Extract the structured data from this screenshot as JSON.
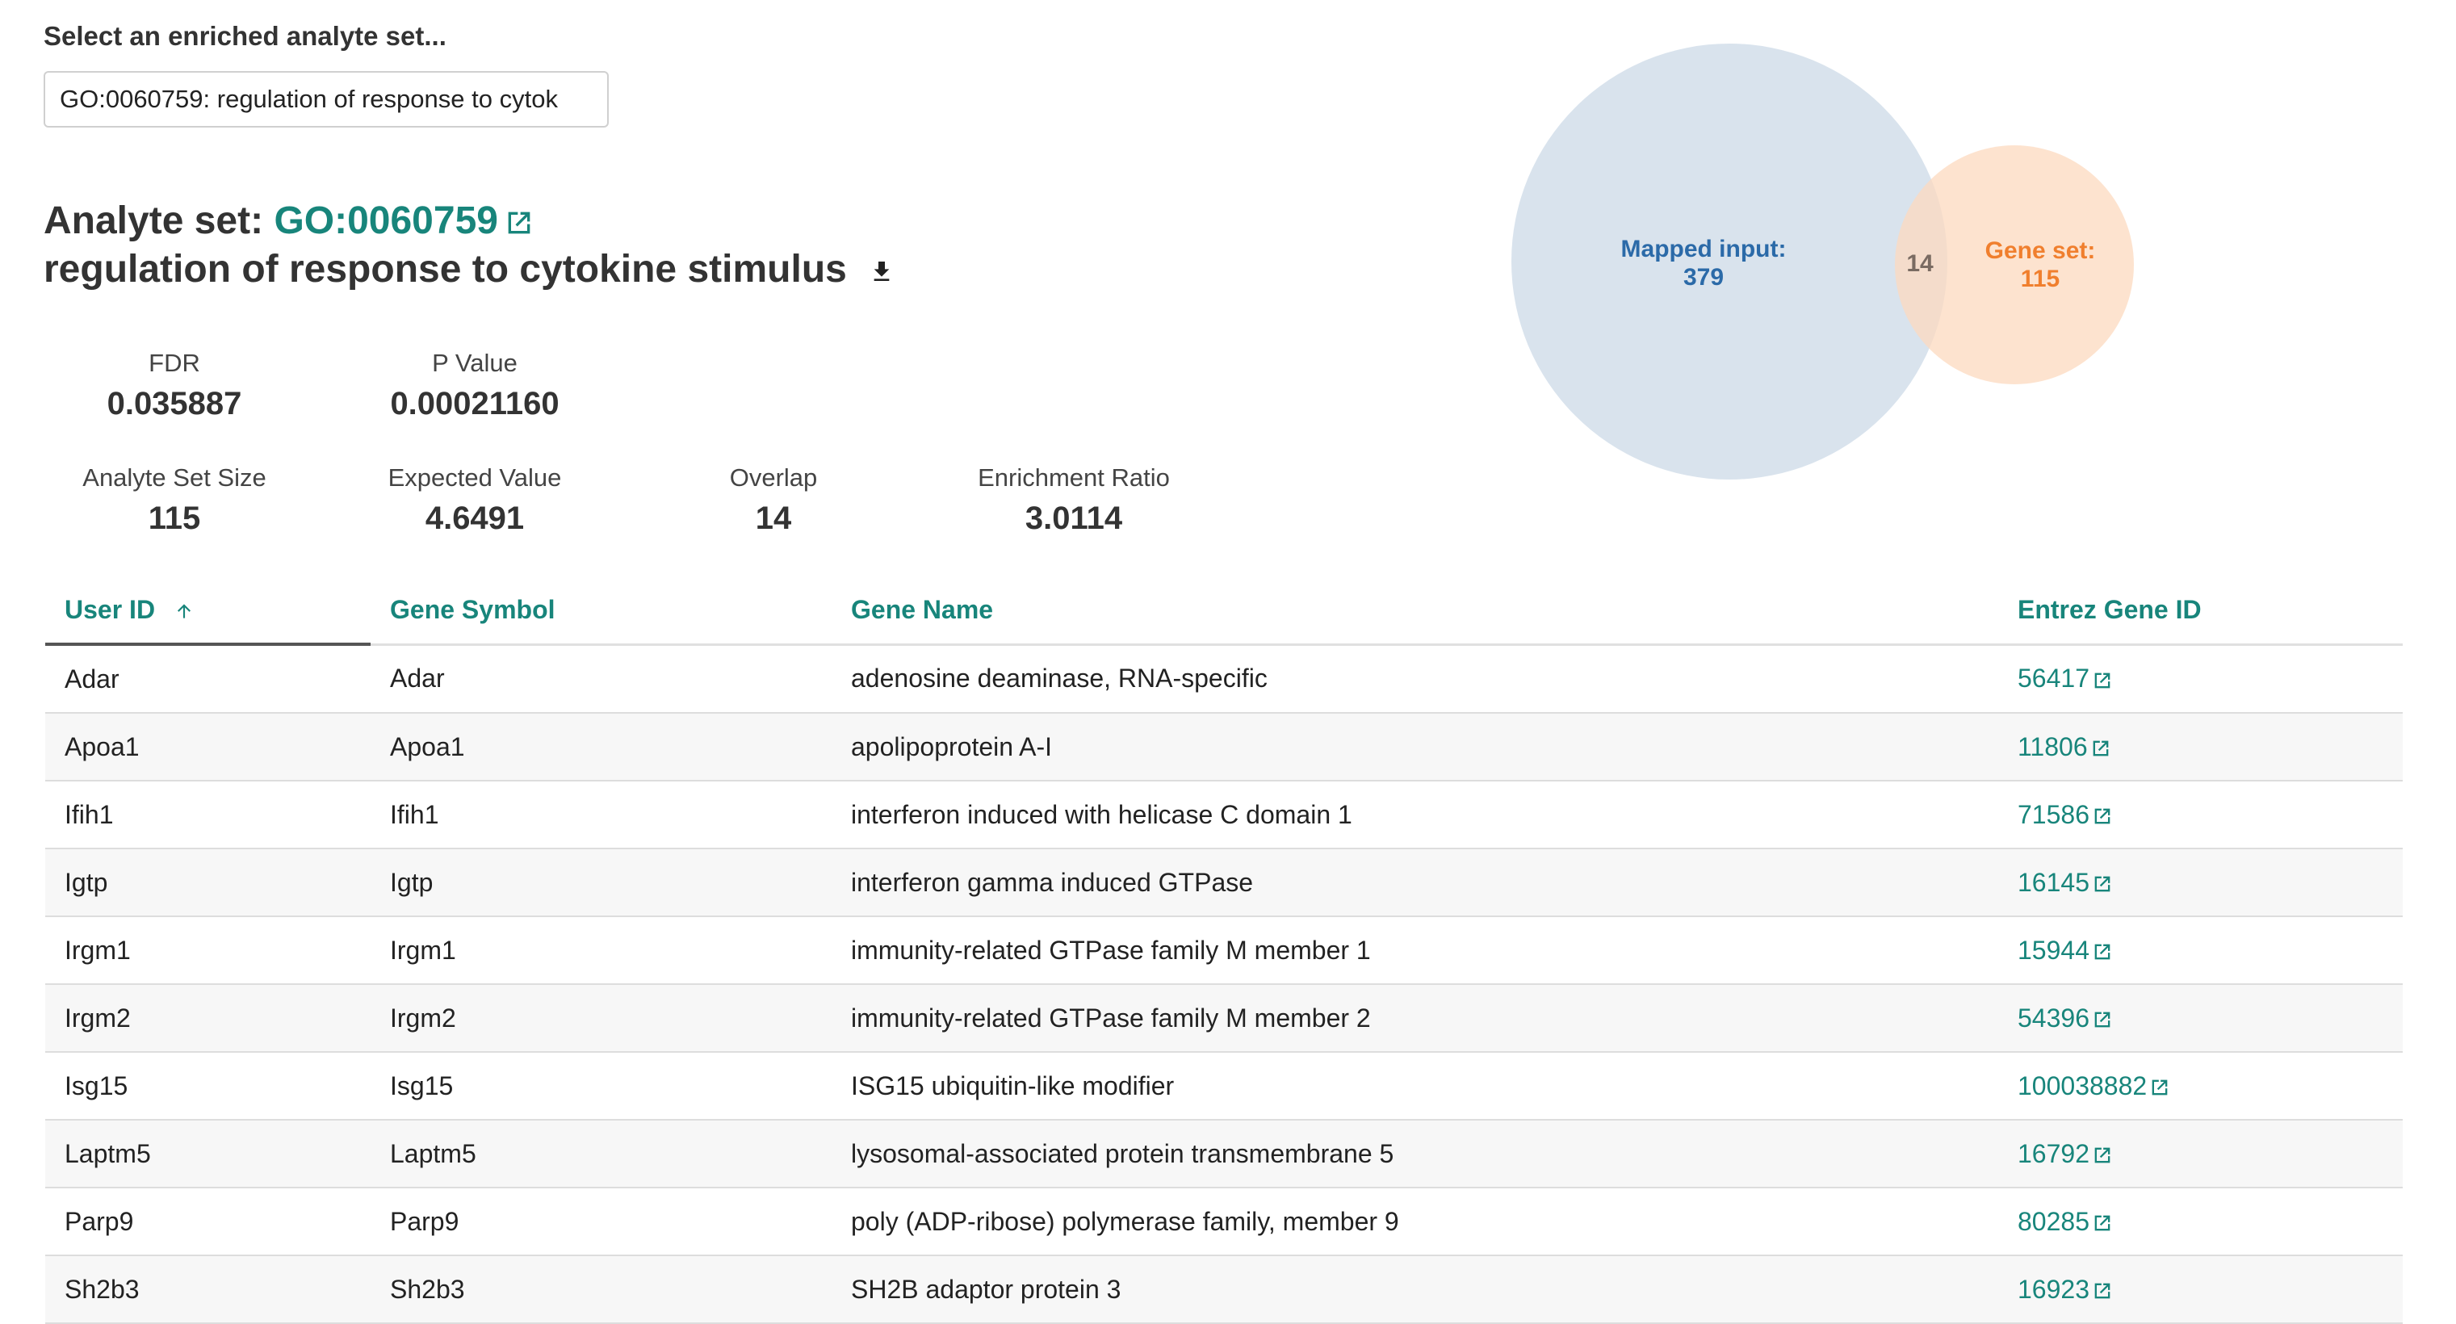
{
  "selector": {
    "label": "Select an enriched analyte set...",
    "value": "GO:0060759: regulation of response to cytok"
  },
  "analyte": {
    "prefix": "Analyte set:",
    "id": "GO:0060759",
    "name": "regulation of response to cytokine stimulus"
  },
  "stats": {
    "fdr_label": "FDR",
    "fdr": "0.035887",
    "p_label": "P Value",
    "p": "0.00021160",
    "size_label": "Analyte Set Size",
    "size": "115",
    "expected_label": "Expected Value",
    "expected": "4.6491",
    "overlap_label": "Overlap",
    "overlap": "14",
    "ratio_label": "Enrichment Ratio",
    "ratio": "3.0114"
  },
  "venn": {
    "mapped_label": "Mapped input:",
    "mapped_value": "379",
    "overlap_value": "14",
    "geneset_label": "Gene set:",
    "geneset_value": "115",
    "mapped_color": "#cfdce8",
    "geneset_color": "#fcd9bf",
    "mapped_text_color": "#2b6aa8",
    "geneset_text_color": "#f07f2e"
  },
  "table": {
    "headers": [
      "User ID",
      "Gene Symbol",
      "Gene Name",
      "Entrez Gene ID"
    ],
    "sort_icon": "arrow-up-icon",
    "rows": [
      [
        "Adar",
        "Adar",
        "adenosine deaminase, RNA-specific",
        "56417"
      ],
      [
        "Apoa1",
        "Apoa1",
        "apolipoprotein A-I",
        "11806"
      ],
      [
        "Ifih1",
        "Ifih1",
        "interferon induced with helicase C domain 1",
        "71586"
      ],
      [
        "Igtp",
        "Igtp",
        "interferon gamma induced GTPase",
        "16145"
      ],
      [
        "Irgm1",
        "Irgm1",
        "immunity-related GTPase family M member 1",
        "15944"
      ],
      [
        "Irgm2",
        "Irgm2",
        "immunity-related GTPase family M member 2",
        "54396"
      ],
      [
        "Isg15",
        "Isg15",
        "ISG15 ubiquitin-like modifier",
        "100038882"
      ],
      [
        "Laptm5",
        "Laptm5",
        "lysosomal-associated protein transmembrane 5",
        "16792"
      ],
      [
        "Parp9",
        "Parp9",
        "poly (ADP-ribose) polymerase family, member 9",
        "80285"
      ],
      [
        "Sh2b3",
        "Sh2b3",
        "SH2B adaptor protein 3",
        "16923"
      ]
    ]
  },
  "colors": {
    "accent": "#18857b"
  }
}
